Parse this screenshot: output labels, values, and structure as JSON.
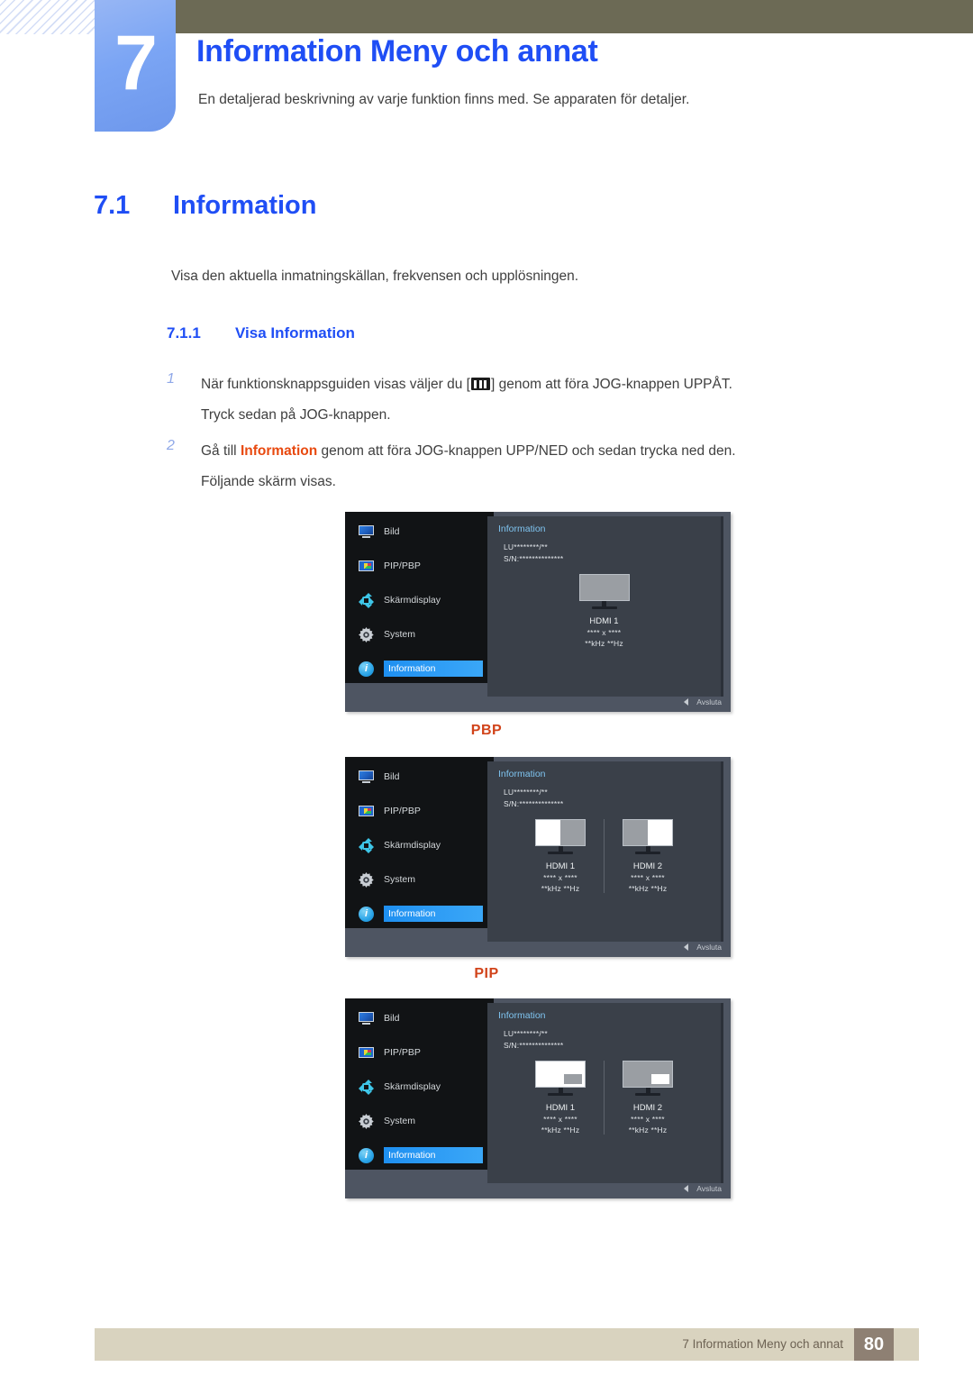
{
  "header": {
    "chapter_number": "7",
    "chapter_title": "Information Meny och annat",
    "chapter_subtitle": "En detaljerad beskrivning av varje funktion finns med. Se apparaten för detaljer."
  },
  "section": {
    "number": "7.1",
    "title": "Information",
    "intro": "Visa den aktuella inmatningskällan, frekvensen och upplösningen."
  },
  "subsection": {
    "number": "7.1.1",
    "title": "Visa Information"
  },
  "steps": [
    {
      "number": "1",
      "text_before_icon": "När funktionsknappsguiden visas väljer du [",
      "icon": "menu-bars-icon",
      "text_after_icon": "] genom att föra JOG-knappen UPPÅT.",
      "line2": "Tryck sedan på JOG-knappen."
    },
    {
      "number": "2",
      "text_before_accent": "Gå till ",
      "accent": "Information",
      "text_after_accent": " genom att föra JOG-knappen UPP/NED och sedan trycka ned den.",
      "line2": "Följande skärm visas."
    }
  ],
  "osd_menu_items": [
    {
      "icon": "monitor-icon",
      "label": "Bild"
    },
    {
      "icon": "pip-pbp-icon",
      "label": "PIP/PBP"
    },
    {
      "icon": "osd-arrows-icon",
      "label": "Skärmdisplay"
    },
    {
      "icon": "gear-icon",
      "label": "System"
    },
    {
      "icon": "info-circle-icon",
      "label": "Information"
    }
  ],
  "osd_common": {
    "panel_title": "Information",
    "model_id": "LU********/**",
    "serial": "S/N:**************",
    "exit_label": "Avsluta",
    "resolution": "**** x ****",
    "frequency": "**kHz **Hz"
  },
  "osd_screens": [
    {
      "mode": "",
      "layout": "single",
      "sources": [
        {
          "name": "HDMI 1",
          "resolution": "**** x ****",
          "frequency": "**kHz **Hz",
          "thumb": "solid-gray"
        }
      ]
    },
    {
      "mode": "PBP",
      "layout": "dual",
      "sources": [
        {
          "name": "HDMI 1",
          "resolution": "**** x ****",
          "frequency": "**kHz **Hz",
          "thumb": "split-white-left"
        },
        {
          "name": "HDMI 2",
          "resolution": "**** x ****",
          "frequency": "**kHz **Hz",
          "thumb": "split-white-right"
        }
      ]
    },
    {
      "mode": "PIP",
      "layout": "dual",
      "sources": [
        {
          "name": "HDMI 1",
          "resolution": "**** x ****",
          "frequency": "**kHz **Hz",
          "thumb": "white-with-gray-inset"
        },
        {
          "name": "HDMI 2",
          "resolution": "**** x ****",
          "frequency": "**kHz **Hz",
          "thumb": "gray-with-white-inset"
        }
      ]
    }
  ],
  "footer": {
    "text": "7 Information Meny och annat",
    "page_number": "80"
  },
  "colors": {
    "heading_blue": "#1f4ef5",
    "accent_orange": "#d1431a",
    "olive_bar": "#6c6a55",
    "badge_blue": "#7ba5f4",
    "footer_bar": "#d9d3bf",
    "footer_page_box": "#8e8073",
    "osd_highlight": "#2f9df5"
  }
}
